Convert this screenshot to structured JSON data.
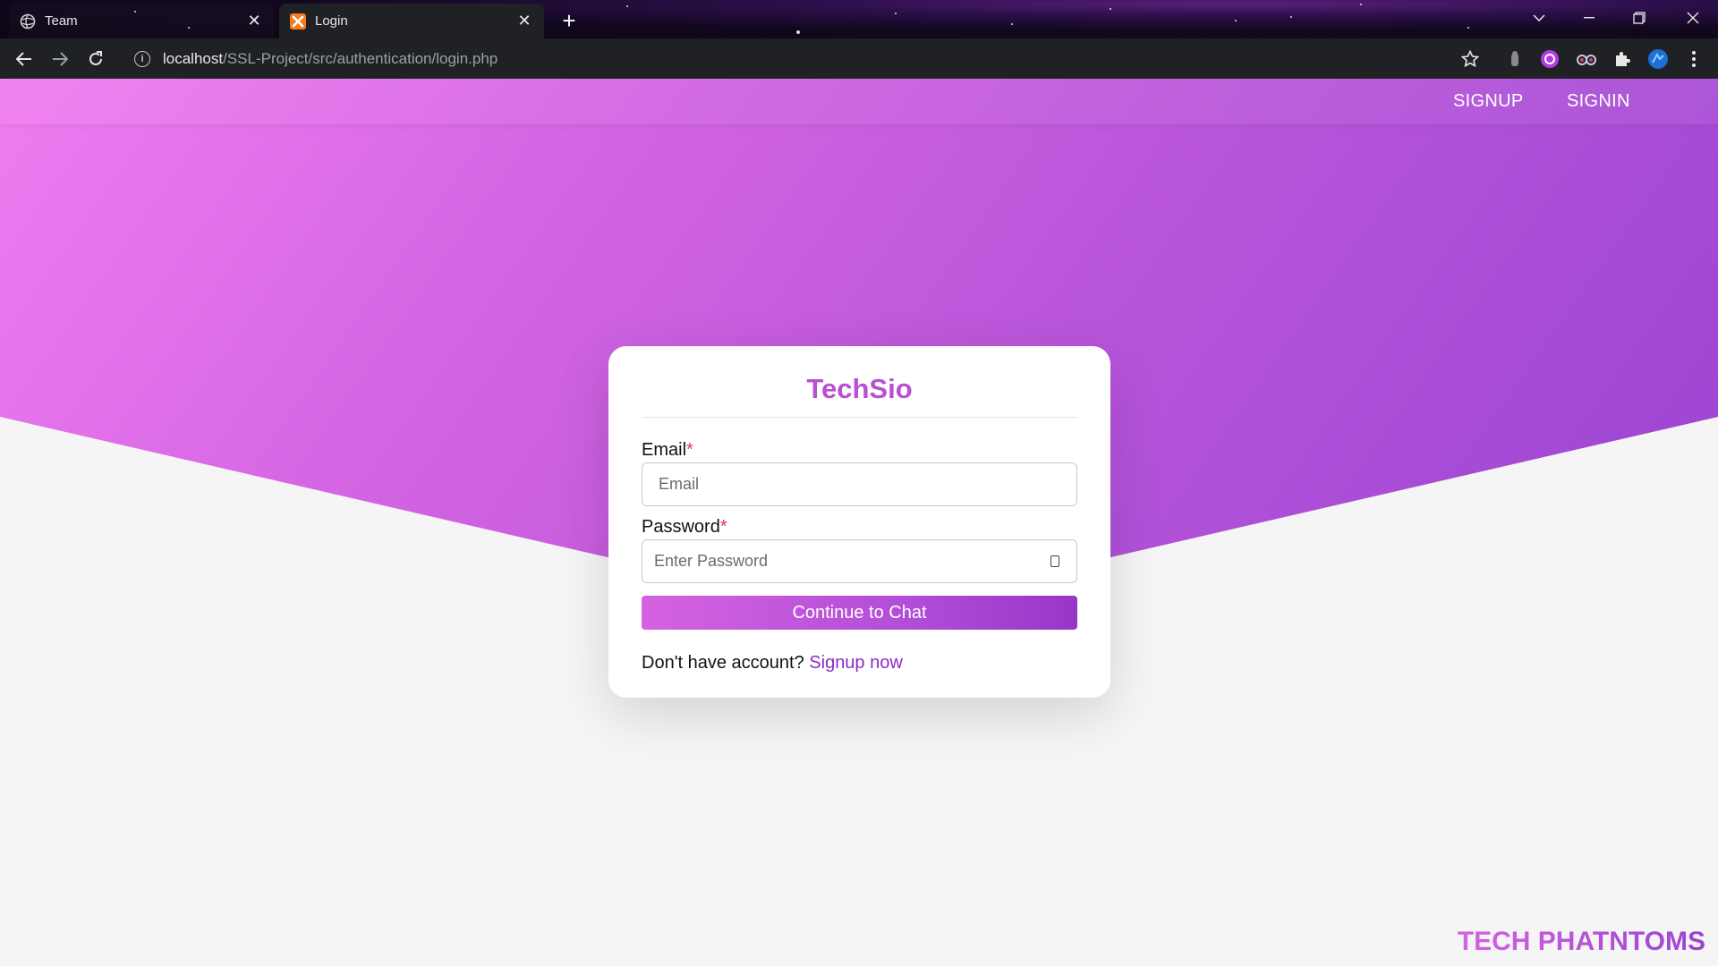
{
  "browser": {
    "tabs": [
      {
        "title": "Team",
        "favicon": "globe-icon",
        "active": false
      },
      {
        "title": "Login",
        "favicon": "xampp-icon",
        "active": true
      }
    ],
    "url_host": "localhost",
    "url_path": "/SSL-Project/src/authentication/login.php"
  },
  "navbar": {
    "signup_label": "SIGNUP",
    "signin_label": "SIGNIN"
  },
  "login_card": {
    "brand": "TechSio",
    "email_label": "Email",
    "email_placeholder": "Email",
    "password_label": "Password",
    "password_placeholder": "Enter Password",
    "required_marker": "*",
    "submit_label": "Continue to Chat",
    "footer_text": "Don't have account?",
    "footer_link": "Signup now"
  },
  "brandmark": "TECH PHATNTOMS",
  "colors": {
    "gradient_start": "#f07cf0",
    "gradient_end": "#9944d2",
    "brand": "#b94fd3",
    "link": "#8a2ec7",
    "required": "#e0334a"
  }
}
